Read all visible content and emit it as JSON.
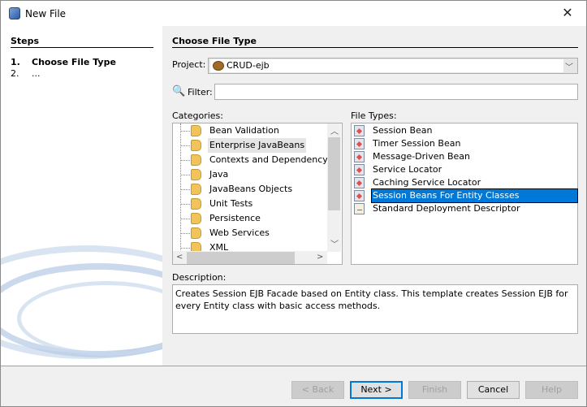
{
  "window": {
    "title": "New File",
    "close": "✕"
  },
  "steps": {
    "heading": "Steps",
    "items": [
      {
        "num": "1.",
        "label": "Choose File Type"
      },
      {
        "num": "2.",
        "label": "..."
      }
    ]
  },
  "panel": {
    "heading": "Choose File Type"
  },
  "project": {
    "label": "Project:",
    "value": "CRUD-ejb"
  },
  "filter": {
    "label": "Filter:",
    "value": ""
  },
  "categories": {
    "label": "Categories:",
    "items": [
      "Bean Validation",
      "Enterprise JavaBeans",
      "Contexts and Dependency Injection",
      "Java",
      "JavaBeans Objects",
      "Unit Tests",
      "Persistence",
      "Web Services",
      "XML"
    ],
    "selected": "Enterprise JavaBeans"
  },
  "file_types": {
    "label": "File Types:",
    "items": [
      "Session Bean",
      "Timer Session Bean",
      "Message-Driven Bean",
      "Service Locator",
      "Caching Service Locator",
      "Session Beans For Entity Classes",
      "Standard Deployment Descriptor"
    ],
    "selected": "Session Beans For Entity Classes"
  },
  "description": {
    "label": "Description:",
    "text": "Creates Session EJB Facade based on Entity class. This template creates Session EJB for every Entity class with basic access methods."
  },
  "buttons": {
    "back": "< Back",
    "next": "Next >",
    "finish": "Finish",
    "cancel": "Cancel",
    "help": "Help"
  }
}
